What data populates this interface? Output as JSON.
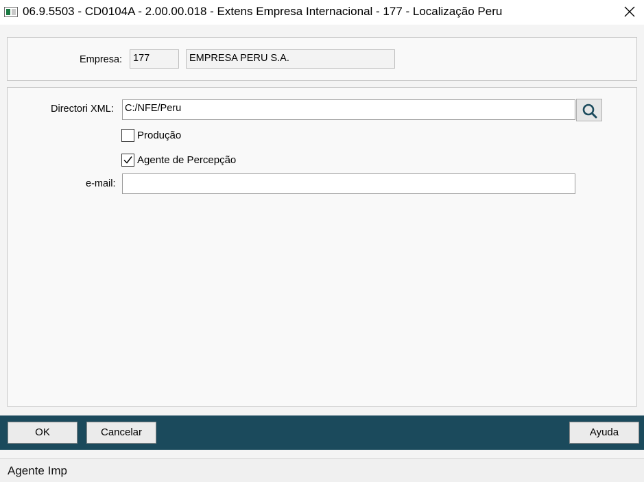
{
  "window": {
    "title": "06.9.5503 - CD0104A - 2.00.00.018 - Extens Empresa Internacional - 177 - Localização Peru",
    "close_icon": "close-icon"
  },
  "company": {
    "label": "Empresa:",
    "code": "177",
    "name": "EMPRESA PERU S.A."
  },
  "form": {
    "xml_dir_label": "Directori XML:",
    "xml_dir_value": "C:/NFE/Peru",
    "search_icon": "search-icon",
    "production": {
      "label": "Produção",
      "checked": false
    },
    "perception_agent": {
      "label": "Agente de Percepção",
      "checked": true
    },
    "email_label": "e-mail:",
    "email_value": ""
  },
  "buttons": {
    "ok": "OK",
    "cancel": "Cancelar",
    "help": "Ayuda"
  },
  "status_bar": {
    "text": "Agente Imp"
  },
  "colors": {
    "button_bar": "#1b4a5c",
    "background": "#f4f4f4",
    "checkbox_check": "#000000"
  }
}
